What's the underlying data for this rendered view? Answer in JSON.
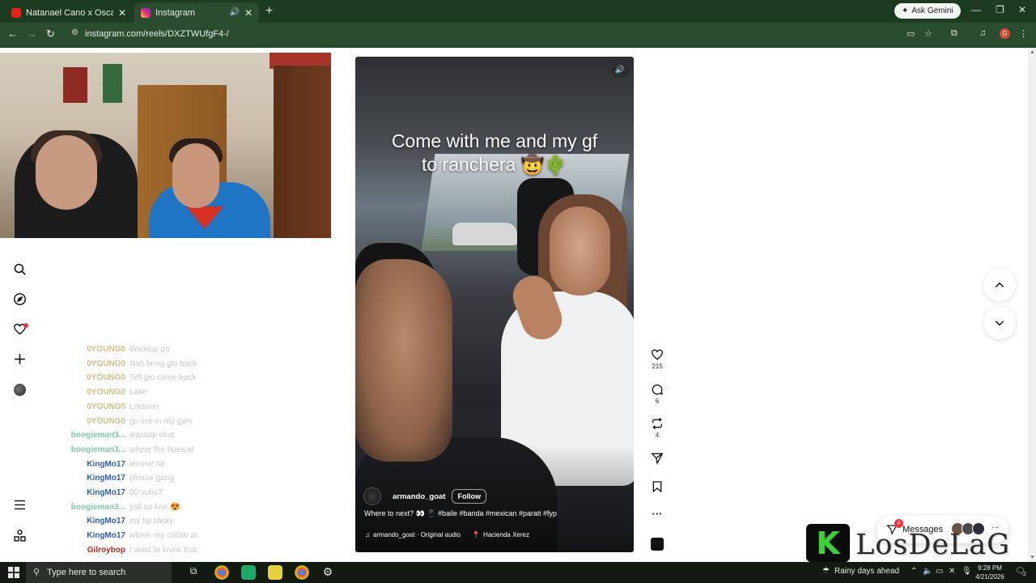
{
  "browser": {
    "tabs": [
      {
        "title": "Natanael Cano x Oscar Maydon",
        "favicon_color": "#e62117",
        "state": "inactive"
      },
      {
        "title": "Instagram",
        "favicon_color": "#d6249f",
        "state": "active"
      }
    ],
    "gemini_label": "Ask Gemini",
    "url": "instagram.com/reels/DXZTWUfgF4-/",
    "profile_letter": "G"
  },
  "chat": [
    {
      "user": "0YOUNG0",
      "color": "#d5c08a",
      "msg": "Wassup pa"
    },
    {
      "user": "0YOUNG0",
      "color": "#d5c08a",
      "msg": "Nah bring gio back"
    },
    {
      "user": "0YOUNG0",
      "color": "#d5c08a",
      "msg": "Tell gio come back"
    },
    {
      "user": "0YOUNG0",
      "color": "#d5c08a",
      "msg": "Lake"
    },
    {
      "user": "0YOUNG0",
      "color": "#d5c08a",
      "msg": "Lmaooo"
    },
    {
      "user": "0YOUNG0",
      "color": "#d5c08a",
      "msg": "go live in my gym"
    },
    {
      "user": "boogieman3...",
      "color": "#7fc9b0",
      "msg": "wassup chat"
    },
    {
      "user": "boogieman3...",
      "color": "#7fc9b0",
      "msg": "where the hoes at"
    },
    {
      "user": "KingMo17",
      "color": "#2f5fb0",
      "msg": "lemme hit"
    },
    {
      "user": "KingMo17",
      "color": "#2f5fb0",
      "msg": "please gang"
    },
    {
      "user": "KingMo17",
      "color": "#2f5fb0",
      "msg": "00 subs?"
    },
    {
      "user": "boogieman3...",
      "color": "#7fc9b0",
      "msg": "yall so fine 😍"
    },
    {
      "user": "KingMo17",
      "color": "#2f5fb0",
      "msg": "my tip sticky"
    },
    {
      "user": "KingMo17",
      "color": "#2f5fb0",
      "msg": "where my collab at"
    },
    {
      "user": "Gilroybop",
      "color": "#b0282a",
      "msg": "I want to know that"
    }
  ],
  "reel": {
    "caption_line1": "Come with me and my gf",
    "caption_line2": "to ranchera 🤠🌵",
    "username": "armando_goat",
    "follow_label": "Follow",
    "description": "Where to next? 👀 📱 #baile #banda #mexican #parati #fyp",
    "audio": "armando_goat · Original audio",
    "location": "Hacienda Xerez"
  },
  "actions": {
    "likes": "215",
    "comments": "6",
    "reposts": "4"
  },
  "messages": {
    "label": "Messages",
    "badge": "4"
  },
  "watermark": {
    "letter": "K",
    "text": "LosDeLaG"
  },
  "taskbar": {
    "search_placeholder": "Type here to search",
    "weather": "Rainy days ahead",
    "time": "9:28 PM",
    "date": "4/21/2026",
    "notif_count": "2"
  }
}
